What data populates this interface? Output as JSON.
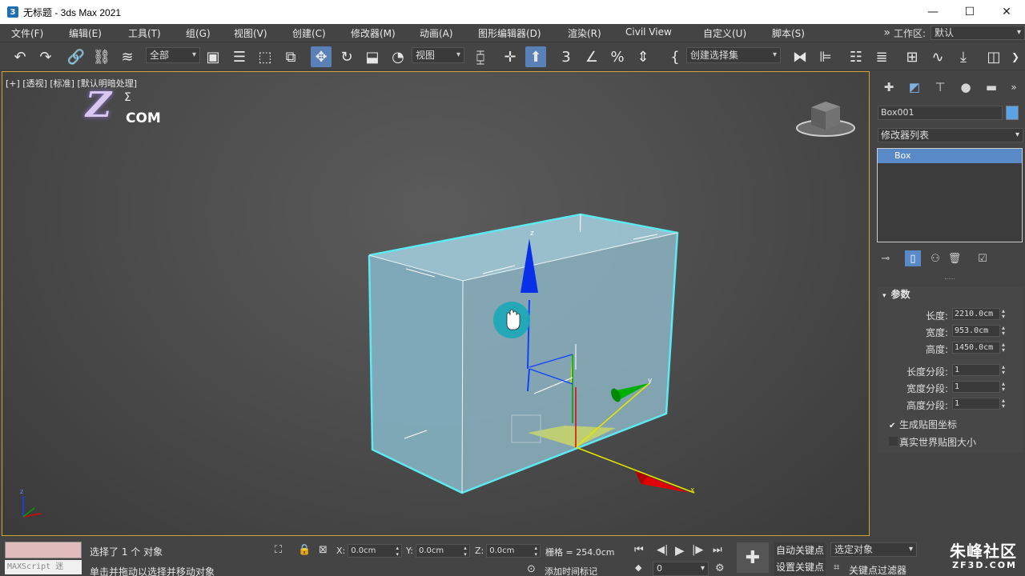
{
  "window": {
    "title": "无标题 - 3ds Max 2021",
    "app_icon": "3",
    "min_icon": "—",
    "max_icon": "☐",
    "close_icon": "✕"
  },
  "menu": {
    "items": [
      "文件(F)",
      "编辑(E)",
      "工具(T)",
      "组(G)",
      "视图(V)",
      "创建(C)",
      "修改器(M)",
      "动画(A)",
      "图形编辑器(D)",
      "渲染(R)",
      "Civil View",
      "自定义(U)",
      "脚本(S)"
    ],
    "overflow": "»",
    "workspace_label": "工作区:",
    "workspace_value": "默认"
  },
  "toolbar": {
    "selection_filter": "全部",
    "ref_coord": "视图",
    "named_selection": "创建选择集",
    "snap_label": "3"
  },
  "viewport": {
    "label": "[+] [透视] [标准] [默认明暗处理]",
    "logo_z": "Z",
    "logo_com": "COM",
    "logo_sigma": "Σ",
    "axis_x": "x",
    "axis_y": "y",
    "axis_z": "z"
  },
  "command_panel": {
    "object_name": "Box001",
    "object_color": "#5aa3e6",
    "modifier_list": "修改器列表",
    "stack_item": "Box",
    "rollout_title": "参数",
    "params": [
      {
        "label": "长度:",
        "value": "2210.0cm"
      },
      {
        "label": "宽度:",
        "value": "953.0cm"
      },
      {
        "label": "高度:",
        "value": "1450.0cm"
      },
      {
        "label": "长度分段:",
        "value": "1"
      },
      {
        "label": "宽度分段:",
        "value": "1"
      },
      {
        "label": "高度分段:",
        "value": "1"
      }
    ],
    "checkboxes": [
      {
        "label": "生成贴图坐标",
        "checked": true
      },
      {
        "label": "真实世界贴图大小",
        "checked": false
      }
    ]
  },
  "status": {
    "maxscript": "MAXScript 迷",
    "selected": "选择了 1 个 对象",
    "hint": "单击并拖动以选择并移动对象",
    "x_label": "X:",
    "x_value": "0.0cm",
    "y_label": "Y:",
    "y_value": "0.0cm",
    "z_label": "Z:",
    "z_value": "0.0cm",
    "grid": "栅格 = 254.0cm",
    "add_time_tag": "添加时间标记",
    "auto_key": "自动关键点",
    "set_key": "设置关键点",
    "selected_object": "选定对象",
    "key_filter": "关键点过滤器",
    "frame": "0",
    "watermark_main": "朱峰社区",
    "watermark_sub": "ZF3D.COM"
  },
  "colors": {
    "selection_outline": "#5ee8f0",
    "box_fill": "#8fb8c8",
    "axis_x": "#e00000",
    "axis_y": "#00a800",
    "axis_z": "#0030e0",
    "viewport_border": "#c8a832"
  }
}
